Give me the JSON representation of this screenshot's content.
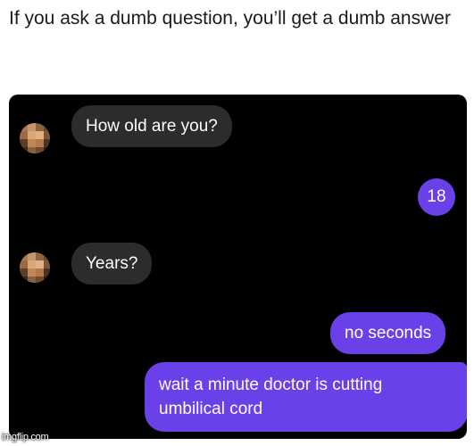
{
  "caption": "If you ask a dumb question, you’ll get a dumb answer",
  "messages": {
    "m1": "How old are you?",
    "m2": "18",
    "m3": "Years?",
    "m4": "no seconds",
    "m5": "wait a minute doctor is cutting\numbilical cord"
  },
  "watermark": "imgflip.com",
  "colors": {
    "incoming_bubble": "#2c2c2e",
    "outgoing_bubble": "#6a40e8",
    "chat_background": "#000000"
  },
  "icons": {
    "avatar": "pixelated-avatar"
  }
}
